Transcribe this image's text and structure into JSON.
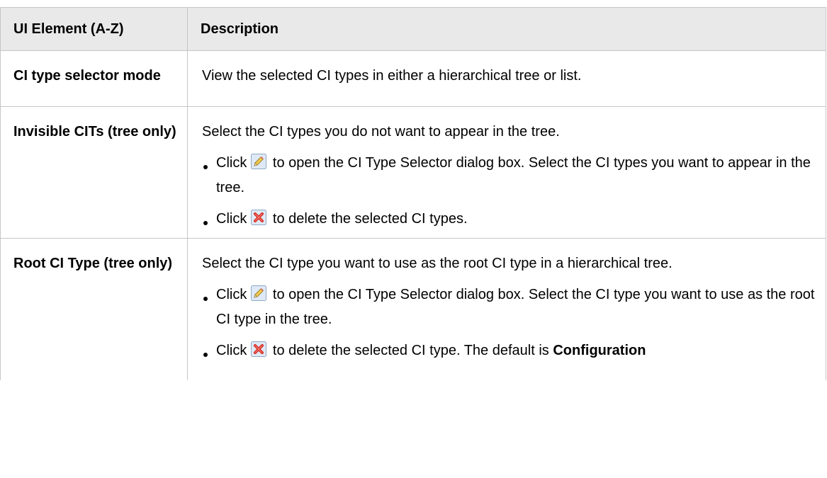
{
  "table": {
    "headers": {
      "element": "UI Element (A-Z)",
      "description": "Description"
    },
    "rows": [
      {
        "element": "CI type selector mode",
        "intro": "View the selected CI types in either a hierarchical tree or list."
      },
      {
        "element": "Invisible CITs (tree only)",
        "intro": "Select the CI types you do not want to appear in the tree.",
        "bullets": [
          {
            "prefix": "Click",
            "icon": "edit-pencil-icon",
            "suffix": "to open the CI Type Selector dialog box. Select the CI types you want to appear in the tree."
          },
          {
            "prefix": "Click",
            "icon": "delete-x-icon",
            "suffix": "to delete the selected CI types."
          }
        ]
      },
      {
        "element": "Root CI Type (tree only)",
        "intro": "Select the CI type you want to use as the root CI type in a hierarchical tree.",
        "bullets": [
          {
            "prefix": "Click",
            "icon": "edit-pencil-icon",
            "suffix": "to open the CI Type Selector dialog box. Select the CI type you want to use as the root CI type in the tree."
          },
          {
            "prefix": "Click",
            "icon": "delete-x-icon",
            "suffix": "to delete the selected CI type. The default is",
            "bold": "Configuration"
          }
        ]
      }
    ]
  },
  "colors": {
    "header_bg": "#e9e9e9",
    "border": "#c6c6c6",
    "delete_icon": "#d9261c",
    "edit_icon_bg": "#dfe9f5"
  }
}
